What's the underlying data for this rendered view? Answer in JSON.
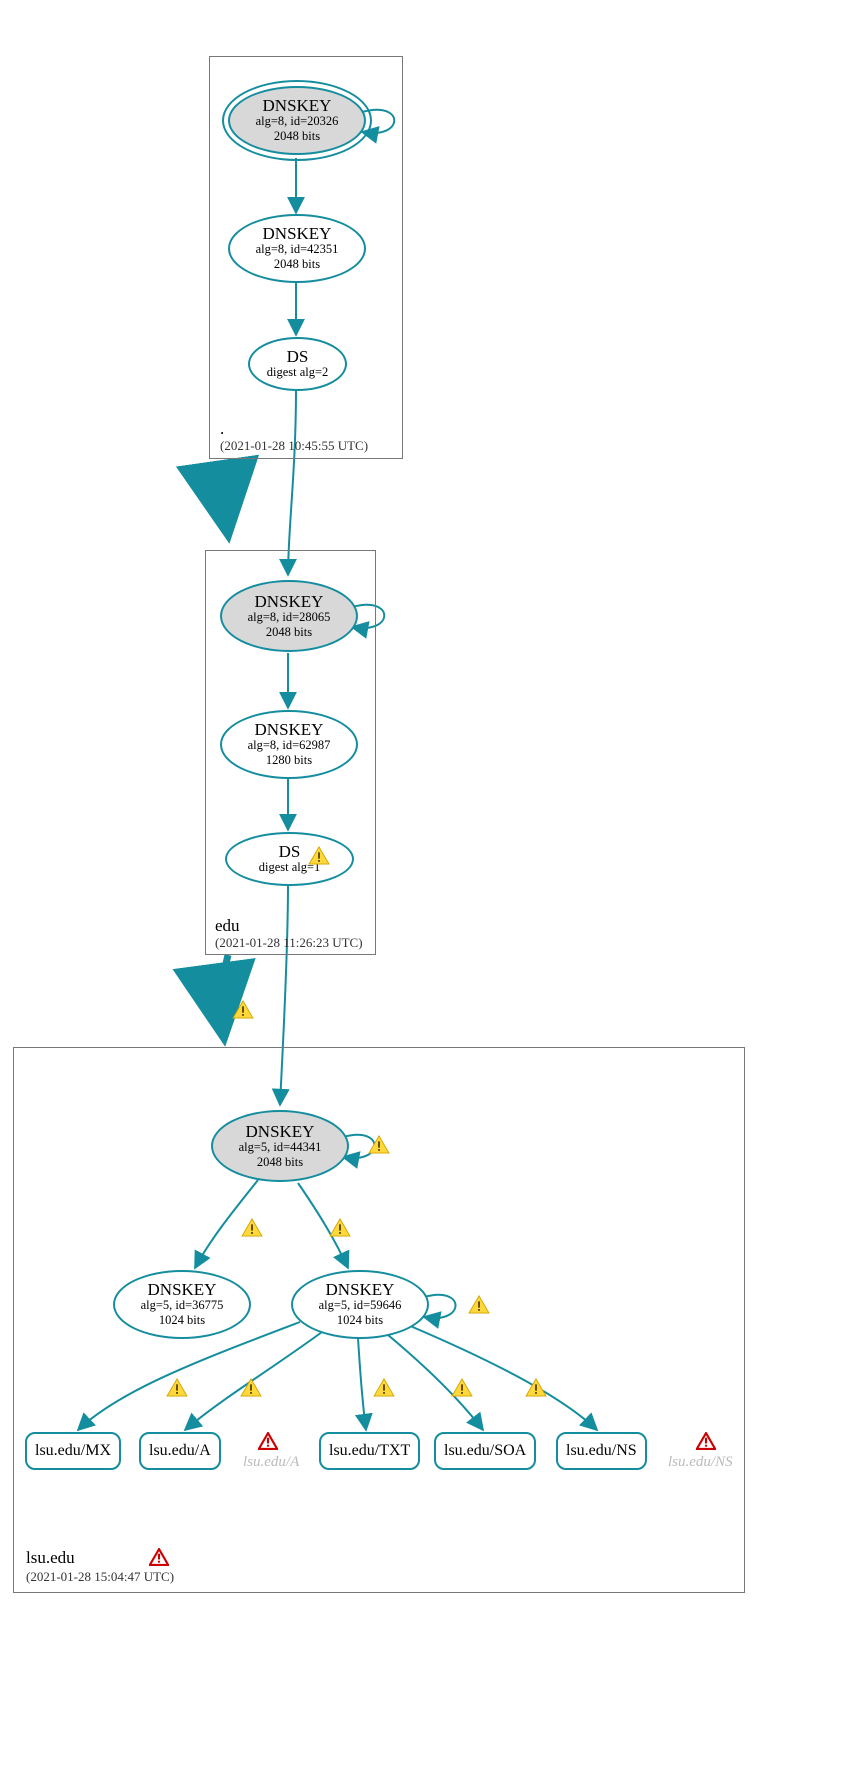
{
  "zones": {
    "root": {
      "name": ".",
      "time": "(2021-01-28 10:45:55 UTC)"
    },
    "edu": {
      "name": "edu",
      "time": "(2021-01-28 11:26:23 UTC)"
    },
    "lsu": {
      "name": "lsu.edu",
      "time": "(2021-01-28 15:04:47 UTC)"
    }
  },
  "nodes": {
    "root_ksk": {
      "title": "DNSKEY",
      "l1": "alg=8, id=20326",
      "l2": "2048 bits"
    },
    "root_zsk": {
      "title": "DNSKEY",
      "l1": "alg=8, id=42351",
      "l2": "2048 bits"
    },
    "root_ds": {
      "title": "DS",
      "l1": "digest alg=2"
    },
    "edu_ksk": {
      "title": "DNSKEY",
      "l1": "alg=8, id=28065",
      "l2": "2048 bits"
    },
    "edu_zsk": {
      "title": "DNSKEY",
      "l1": "alg=8, id=62987",
      "l2": "1280 bits"
    },
    "edu_ds": {
      "title": "DS",
      "l1": "digest alg=1"
    },
    "lsu_ksk": {
      "title": "DNSKEY",
      "l1": "alg=5, id=44341",
      "l2": "2048 bits"
    },
    "lsu_zsk1": {
      "title": "DNSKEY",
      "l1": "alg=5, id=36775",
      "l2": "1024 bits"
    },
    "lsu_zsk2": {
      "title": "DNSKEY",
      "l1": "alg=5, id=59646",
      "l2": "1024 bits"
    }
  },
  "rr": {
    "mx": "lsu.edu/MX",
    "a": "lsu.edu/A",
    "txt": "lsu.edu/TXT",
    "soa": "lsu.edu/SOA",
    "ns": "lsu.edu/NS"
  },
  "grey": {
    "a": "lsu.edu/A",
    "ns": "lsu.edu/NS"
  }
}
